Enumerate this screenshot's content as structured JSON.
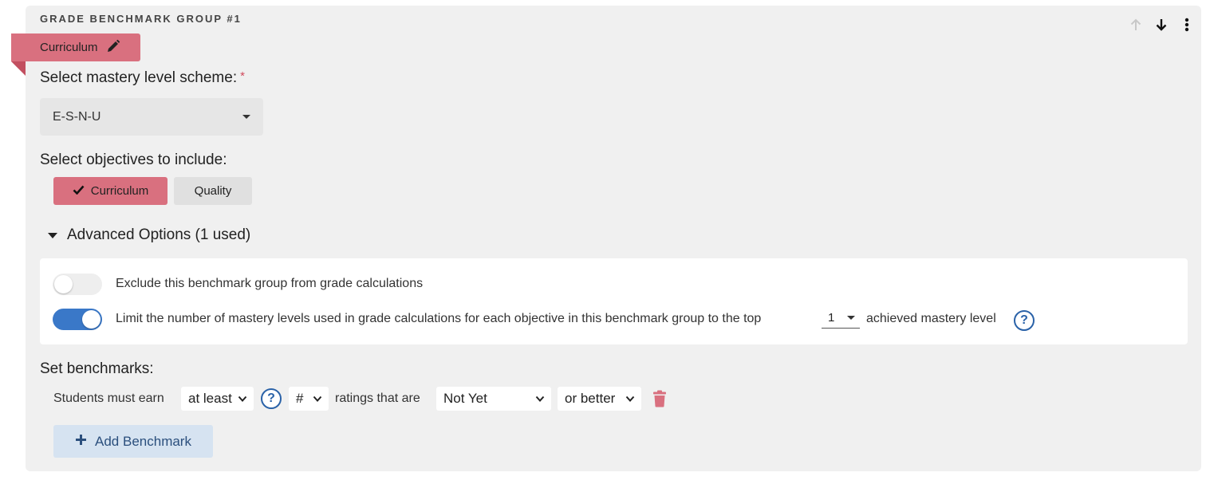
{
  "group": {
    "title": "GRADE BENCHMARK GROUP #1",
    "controls": [
      "arrow-up-icon",
      "arrow-down-icon",
      "more-vertical-icon"
    ]
  },
  "ribbon": {
    "label": "Curriculum",
    "icon": "pencil-icon",
    "color": "#d9707f"
  },
  "scheme": {
    "label": "Select mastery level scheme:",
    "required_mark": "*",
    "selected": "E-S-N-U"
  },
  "objectives": {
    "label": "Select objectives to include:",
    "options": [
      {
        "label": "Curriculum",
        "selected": true
      },
      {
        "label": "Quality",
        "selected": false
      }
    ]
  },
  "advanced": {
    "toggle_label": "Advanced Options (1 used)",
    "exclude": {
      "label": "Exclude this benchmark group from grade calculations",
      "enabled": false
    },
    "limit": {
      "label_before": "Limit the number of mastery levels used in grade calculations for each objective in this benchmark group to the top",
      "value": "1",
      "label_after": "achieved mastery level",
      "enabled": true
    }
  },
  "benchmarks": {
    "label": "Set benchmarks:",
    "rows": [
      {
        "prefix": "Students must earn",
        "comparator": "at least",
        "count": "#",
        "middle": "ratings that are",
        "rating": "Not Yet",
        "qualifier": "or better"
      }
    ],
    "add_label": "Add Benchmark"
  },
  "colors": {
    "accent": "#d9707f",
    "toggle_on": "#3a78c8",
    "help": "#2a62a8",
    "add_bg": "#d6e3f1"
  }
}
